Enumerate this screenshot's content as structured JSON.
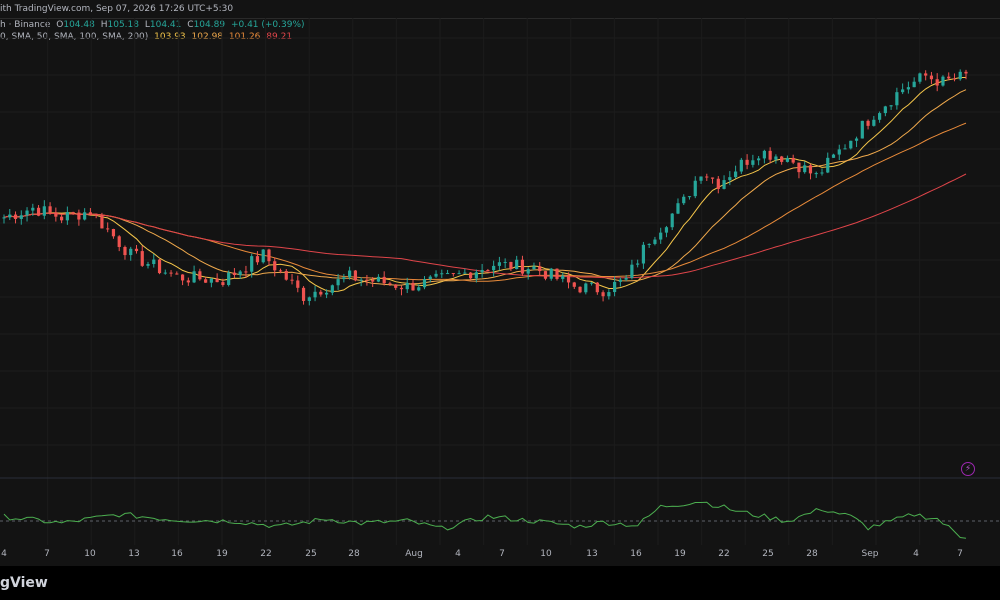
{
  "header": {
    "text": "ith TradingView.com, Sep 07, 2026 17:26 UTC+5:30"
  },
  "legend": {
    "symbol": "h · Binance",
    "o_label": "O",
    "o_value": "104.48",
    "h_label": "H",
    "h_value": "105.18",
    "l_label": "L",
    "l_value": "104.41",
    "c_label": "C",
    "c_value": "104.89",
    "change": "+0.41 (+0.39%)",
    "sma_params": "0, SMA, 50, SMA, 100, SMA, 200)",
    "sma_values": [
      "103.93",
      "102.98",
      "101.26",
      "89.21"
    ]
  },
  "brand": {
    "text": "gView"
  },
  "colors": {
    "up": "#26a69a",
    "down": "#ef5350",
    "sma_20": "#f5c64a",
    "sma_50": "#f0a94c",
    "sma_100": "#e98b3a",
    "sma_200": "#e0454a",
    "oscillator": "#4caf50",
    "alert_icon": "#9c27b0"
  },
  "icons": {
    "alert": "lightning-bolt-icon"
  },
  "chart_data": {
    "type": "candlestick",
    "x_ticks": [
      "4",
      "7",
      "10",
      "13",
      "16",
      "19",
      "22",
      "25",
      "28",
      "Aug",
      "4",
      "7",
      "10",
      "13",
      "16",
      "19",
      "22",
      "25",
      "28",
      "Sep",
      "4",
      "7"
    ],
    "price_series_shape": [
      [
        0,
        0.55
      ],
      [
        5,
        0.58
      ],
      [
        10,
        0.55
      ],
      [
        15,
        0.57
      ],
      [
        22,
        0.43
      ],
      [
        30,
        0.36
      ],
      [
        38,
        0.35
      ],
      [
        45,
        0.43
      ],
      [
        52,
        0.3
      ],
      [
        60,
        0.36
      ],
      [
        70,
        0.33
      ],
      [
        78,
        0.36
      ],
      [
        85,
        0.4
      ],
      [
        92,
        0.39
      ],
      [
        99,
        0.33
      ],
      [
        104,
        0.32
      ],
      [
        108,
        0.35
      ],
      [
        112,
        0.48
      ],
      [
        118,
        0.6
      ],
      [
        121,
        0.7
      ],
      [
        124,
        0.66
      ],
      [
        128,
        0.72
      ],
      [
        131,
        0.76
      ],
      [
        136,
        0.74
      ],
      [
        141,
        0.68
      ],
      [
        146,
        0.78
      ],
      [
        151,
        0.88
      ],
      [
        156,
        0.96
      ],
      [
        160,
        1.0
      ],
      [
        163,
        0.98
      ],
      [
        167,
        1.0
      ]
    ],
    "oscillator_shape": [
      [
        0,
        0.2
      ],
      [
        10,
        -0.1
      ],
      [
        20,
        0.3
      ],
      [
        30,
        0.05
      ],
      [
        40,
        0.0
      ],
      [
        48,
        -0.25
      ],
      [
        56,
        0.1
      ],
      [
        62,
        -0.1
      ],
      [
        70,
        0.0
      ],
      [
        76,
        -0.35
      ],
      [
        84,
        0.2
      ],
      [
        92,
        0.0
      ],
      [
        100,
        -0.25
      ],
      [
        104,
        -0.05
      ],
      [
        110,
        -0.2
      ],
      [
        114,
        0.65
      ],
      [
        121,
        0.9
      ],
      [
        128,
        0.4
      ],
      [
        136,
        0.0
      ],
      [
        142,
        0.55
      ],
      [
        147,
        0.2
      ],
      [
        150,
        -0.3
      ],
      [
        153,
        -0.1
      ],
      [
        158,
        0.3
      ],
      [
        162,
        0.1
      ],
      [
        166,
        -0.7
      ]
    ]
  }
}
